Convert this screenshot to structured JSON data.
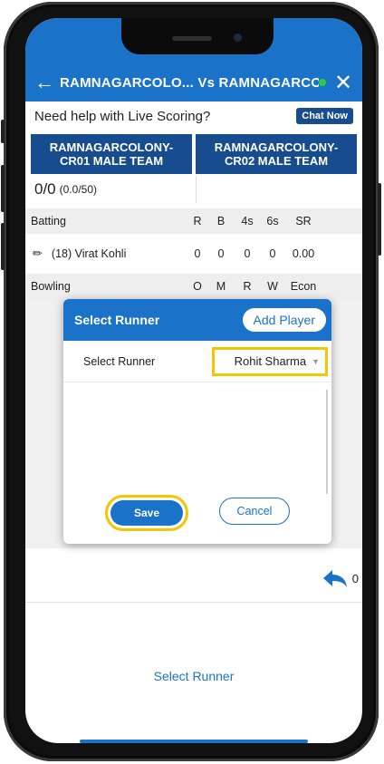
{
  "header": {
    "title": "RAMNAGARCOLO...  Vs  RAMNAGARCOLO."
  },
  "help": {
    "text": "Need help with Live Scoring?",
    "chat_label": "Chat Now"
  },
  "teams": [
    {
      "name": "RAMNAGARCOLONY-CR01 MALE TEAM"
    },
    {
      "name": "RAMNAGARCOLONY-CR02 MALE TEAM"
    }
  ],
  "score": {
    "runs": "0/0",
    "overs": "(0.0/50)"
  },
  "batting": {
    "label": "Batting",
    "columns": [
      "R",
      "B",
      "4s",
      "6s",
      "SR"
    ],
    "rows": [
      {
        "name": "(18) Virat Kohli",
        "values": [
          "0",
          "0",
          "0",
          "0",
          "0.00"
        ]
      }
    ]
  },
  "bowling": {
    "label": "Bowling",
    "columns": [
      "O",
      "M",
      "R",
      "W",
      "Econ"
    ]
  },
  "modal": {
    "title": "Select Runner",
    "add_label": "Add Player",
    "field_label": "Select Runner",
    "selected": "Rohit Sharma",
    "save_label": "Save",
    "cancel_label": "Cancel"
  },
  "undo": {
    "count": "0"
  },
  "footer": {
    "link": "Select Runner"
  },
  "colors": {
    "primary": "#1a73c8",
    "team_card": "#174d8f",
    "highlight": "#f2c600",
    "live_dot": "#2ecc40"
  }
}
